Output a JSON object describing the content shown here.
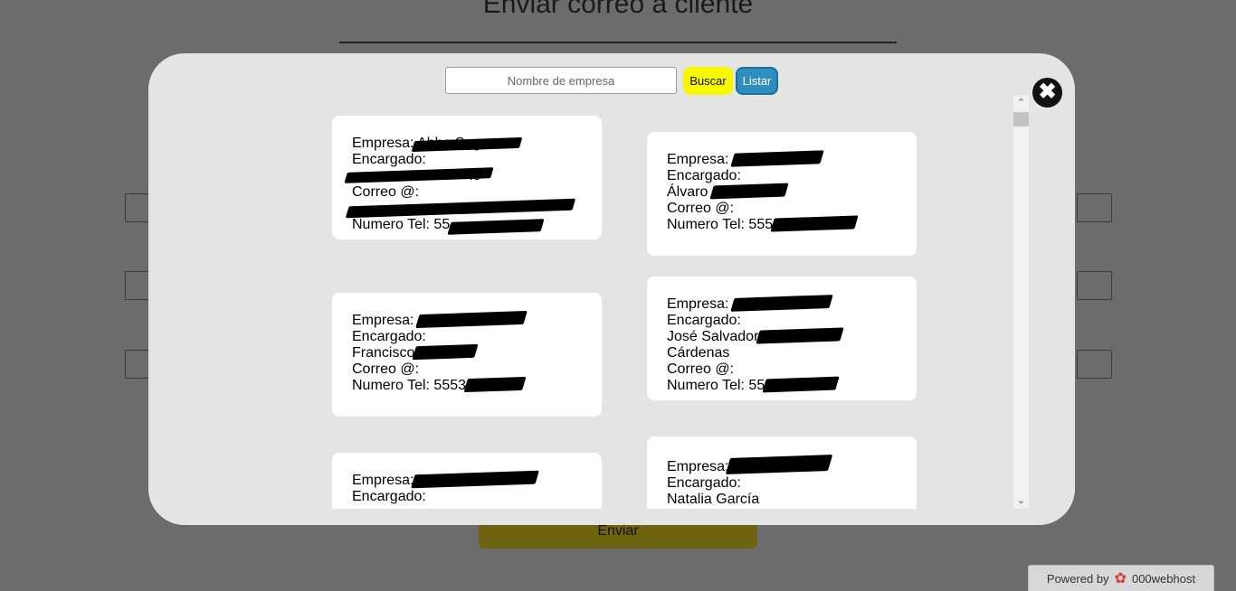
{
  "background": {
    "title": "Enviar correo a cliente",
    "send_label": "Enviar",
    "powered_by": "Powered by",
    "host_brand": "000webhost"
  },
  "modal": {
    "search_placeholder": "Nombre de empresa",
    "search_value": "",
    "buscar_label": "Buscar",
    "listar_label": "Listar",
    "close_icon": "close-x-icon"
  },
  "labels": {
    "empresa": "Empresa:",
    "encargado": "Encargado:",
    "correo": "Correo @:",
    "tel": "Numero Tel:"
  },
  "cards": [
    {
      "empresa": "Abba Sog",
      "encargado": "",
      "encargado_name": "lo",
      "correo": "",
      "tel": "55"
    },
    {
      "empresa": "",
      "encargado_name": "Álvaro",
      "correo": "",
      "tel": "555"
    },
    {
      "empresa": "",
      "encargado_name": "Francisco",
      "correo": "",
      "tel": "5553"
    },
    {
      "empresa": "",
      "encargado_name": "José Salvador",
      "encargado_name2": "Cárdenas",
      "correo": "",
      "tel": "55"
    },
    {
      "empresa": "",
      "encargado_name": "",
      "correo": "",
      "tel": ""
    },
    {
      "empresa": "",
      "encargado_name": "Natalia García",
      "correo": "",
      "tel": ""
    }
  ]
}
